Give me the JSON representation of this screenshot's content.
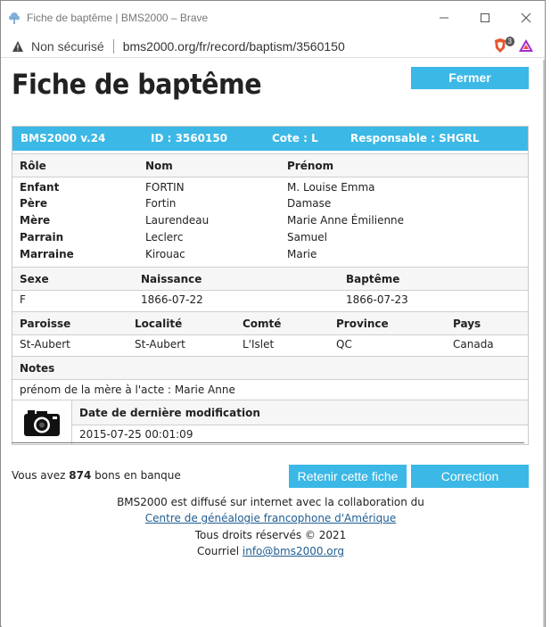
{
  "browser": {
    "window_title": "Fiche de baptême | BMS2000 – Brave",
    "not_secure": "Non sécurisé",
    "url": "bms2000.org/fr/record/baptism/3560150",
    "shield_count": "3",
    "icons": [
      "app-tree-icon",
      "minimize-icon",
      "maximize-icon",
      "close-icon",
      "warning-icon",
      "brave-shield-icon",
      "brave-rewards-icon"
    ]
  },
  "page": {
    "title": "Fiche de baptême",
    "close_button": "Fermer"
  },
  "record": {
    "header": {
      "version": "BMS2000 v.24",
      "id": "ID : 3560150",
      "cote": "Cote : L",
      "responsable": "Responsable : SHGRL"
    },
    "persons_columns": [
      "Rôle",
      "Nom",
      "Prénom"
    ],
    "persons": [
      {
        "role": "Enfant",
        "nom": "FORTIN",
        "prenom": "M. Louise Emma"
      },
      {
        "role": "Père",
        "nom": "Fortin",
        "prenom": "Damase"
      },
      {
        "role": "Mère",
        "nom": "Laurendeau",
        "prenom": "Marie Anne Émilienne"
      },
      {
        "role": "Parrain",
        "nom": "Leclerc",
        "prenom": "Samuel"
      },
      {
        "role": "Marraine",
        "nom": "Kirouac",
        "prenom": "Marie"
      }
    ],
    "dates_columns": [
      "Sexe",
      "Naissance",
      "Baptême"
    ],
    "dates": {
      "sexe": "F",
      "naissance": "1866-07-22",
      "bapteme": "1866-07-23"
    },
    "place_columns": [
      "Paroisse",
      "Localité",
      "Comté",
      "Province",
      "Pays"
    ],
    "place": {
      "paroisse": "St-Aubert",
      "localite": "St-Aubert",
      "comte": "L'Islet",
      "province": "QC",
      "pays": "Canada"
    },
    "notes_label": "Notes",
    "notes": "prénom de la mère à l'acte : Marie Anne",
    "modif_label": "Date de dernière modification",
    "modif_value": "2015-07-25 00:01:09"
  },
  "bank": {
    "prefix": "Vous avez",
    "count": "874",
    "suffix": "bons en banque"
  },
  "actions": {
    "keep": "Retenir cette fiche",
    "correction": "Correction"
  },
  "footer": {
    "line1": "BMS2000 est diffusé sur internet avec la collaboration du",
    "link1": "Centre de généalogie francophone d'Amérique",
    "line3": "Tous droits réservés © 2021",
    "contact_prefix": "Courriel",
    "email": "info@bms2000.org"
  },
  "colors": {
    "accent": "#3bb8e6",
    "link": "#1f5d92"
  }
}
